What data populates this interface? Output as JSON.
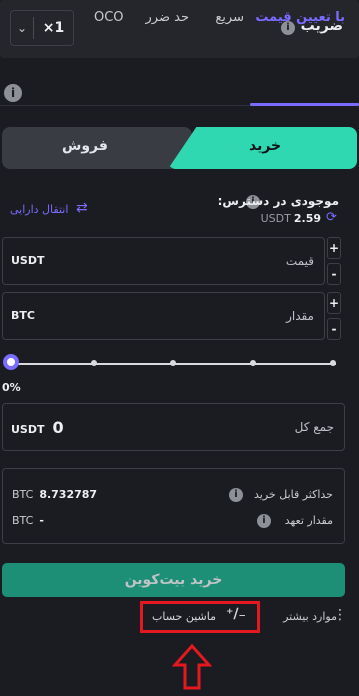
{
  "multiplier": {
    "label": "ضریب",
    "value": "×1",
    "chevron": "chevron-down-icon",
    "info": "i"
  },
  "tabs": [
    {
      "label": "با تعیین قیمت",
      "active": true
    },
    {
      "label": "سریع",
      "active": false
    },
    {
      "label": "حد ضرر",
      "active": false
    },
    {
      "label": "OCO",
      "active": false
    }
  ],
  "tabs_info": "i",
  "side": {
    "buy": "خرید",
    "sell": "فروش"
  },
  "available": {
    "label": "موجودی در دسترس:",
    "value": "2.59",
    "unit": "USDT",
    "transfer": "انتقال دارایی",
    "info": "i"
  },
  "price": {
    "label": "قیمت",
    "unit": "USDT"
  },
  "amount": {
    "label": "مقدار",
    "unit": "BTC"
  },
  "stepper": {
    "plus": "+",
    "minus": "-"
  },
  "slider": {
    "percent": "0%",
    "value_fraction": 0
  },
  "total": {
    "label": "جمع کل",
    "value": "0",
    "unit": "USDT"
  },
  "max_buy": {
    "label": "حداکثر قابل خرید",
    "value": "8.732787",
    "unit": "BTC",
    "info": "i"
  },
  "commitment": {
    "label": "مقدار تعهد",
    "value": "-",
    "unit": "BTC",
    "info": "i"
  },
  "submit": {
    "label": "خرید بیت‌کوین"
  },
  "more": {
    "label": "موارد بیشتر"
  },
  "calculator": {
    "label": "ماشین حساب"
  },
  "colors": {
    "accent": "#7a6cff",
    "buy": "#2fd8b0",
    "submit": "#1d8f77",
    "highlight": "#e3191f"
  }
}
